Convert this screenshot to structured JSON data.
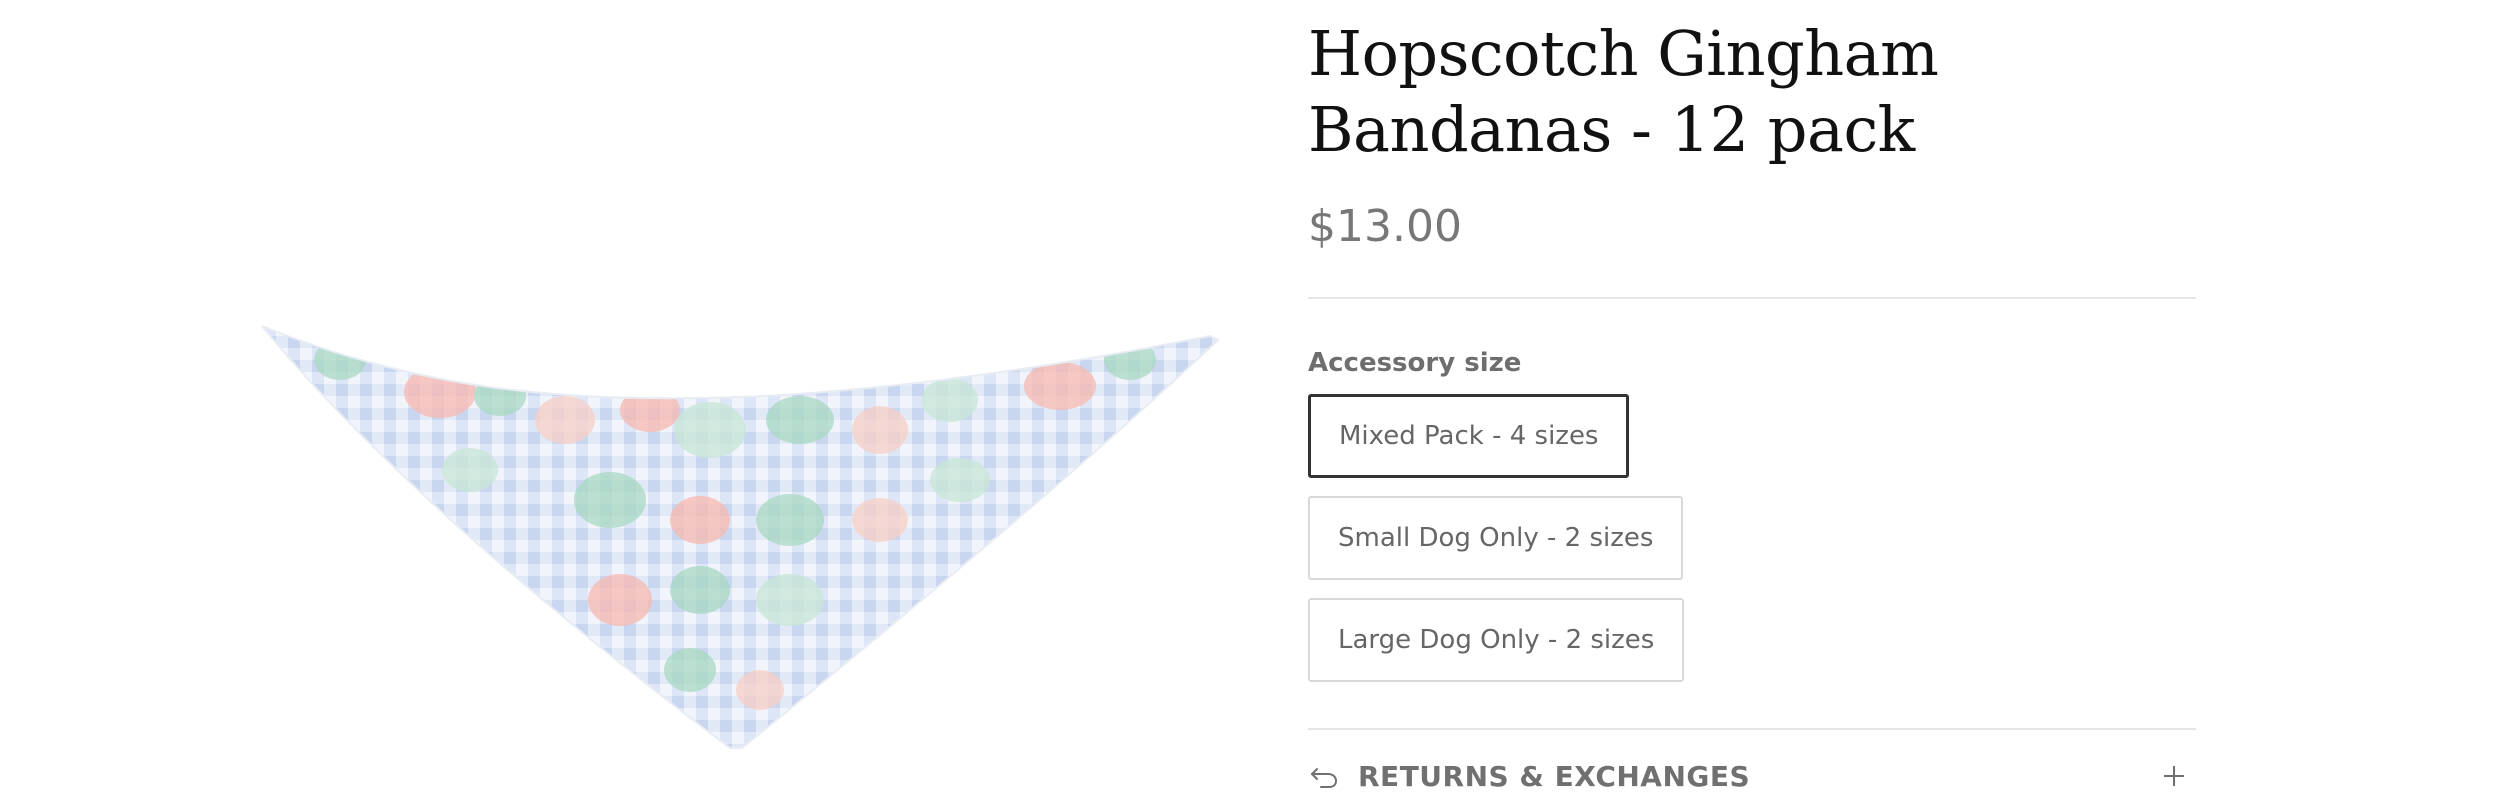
{
  "product": {
    "title": "Hopscotch Gingham Bandanas - 12 pack",
    "price": "$13.00",
    "image_alt": "bandana",
    "option": {
      "label": "Accessory size",
      "values": [
        {
          "label": "Mixed Pack - 4 sizes",
          "selected": true
        },
        {
          "label": "Small Dog Only - 2 sizes",
          "selected": false
        },
        {
          "label": "Large Dog Only - 2 sizes",
          "selected": false
        }
      ]
    },
    "accordion": {
      "returns_label": "RETURNS & EXCHANGES",
      "icon": "return-arrow-icon",
      "toggle_icon": "plus-icon"
    }
  },
  "colors": {
    "gingham": "#c9d6ef",
    "egg_green": "#a8d8c2",
    "egg_pink": "#f7b9b0",
    "selected_border": "#333333"
  }
}
